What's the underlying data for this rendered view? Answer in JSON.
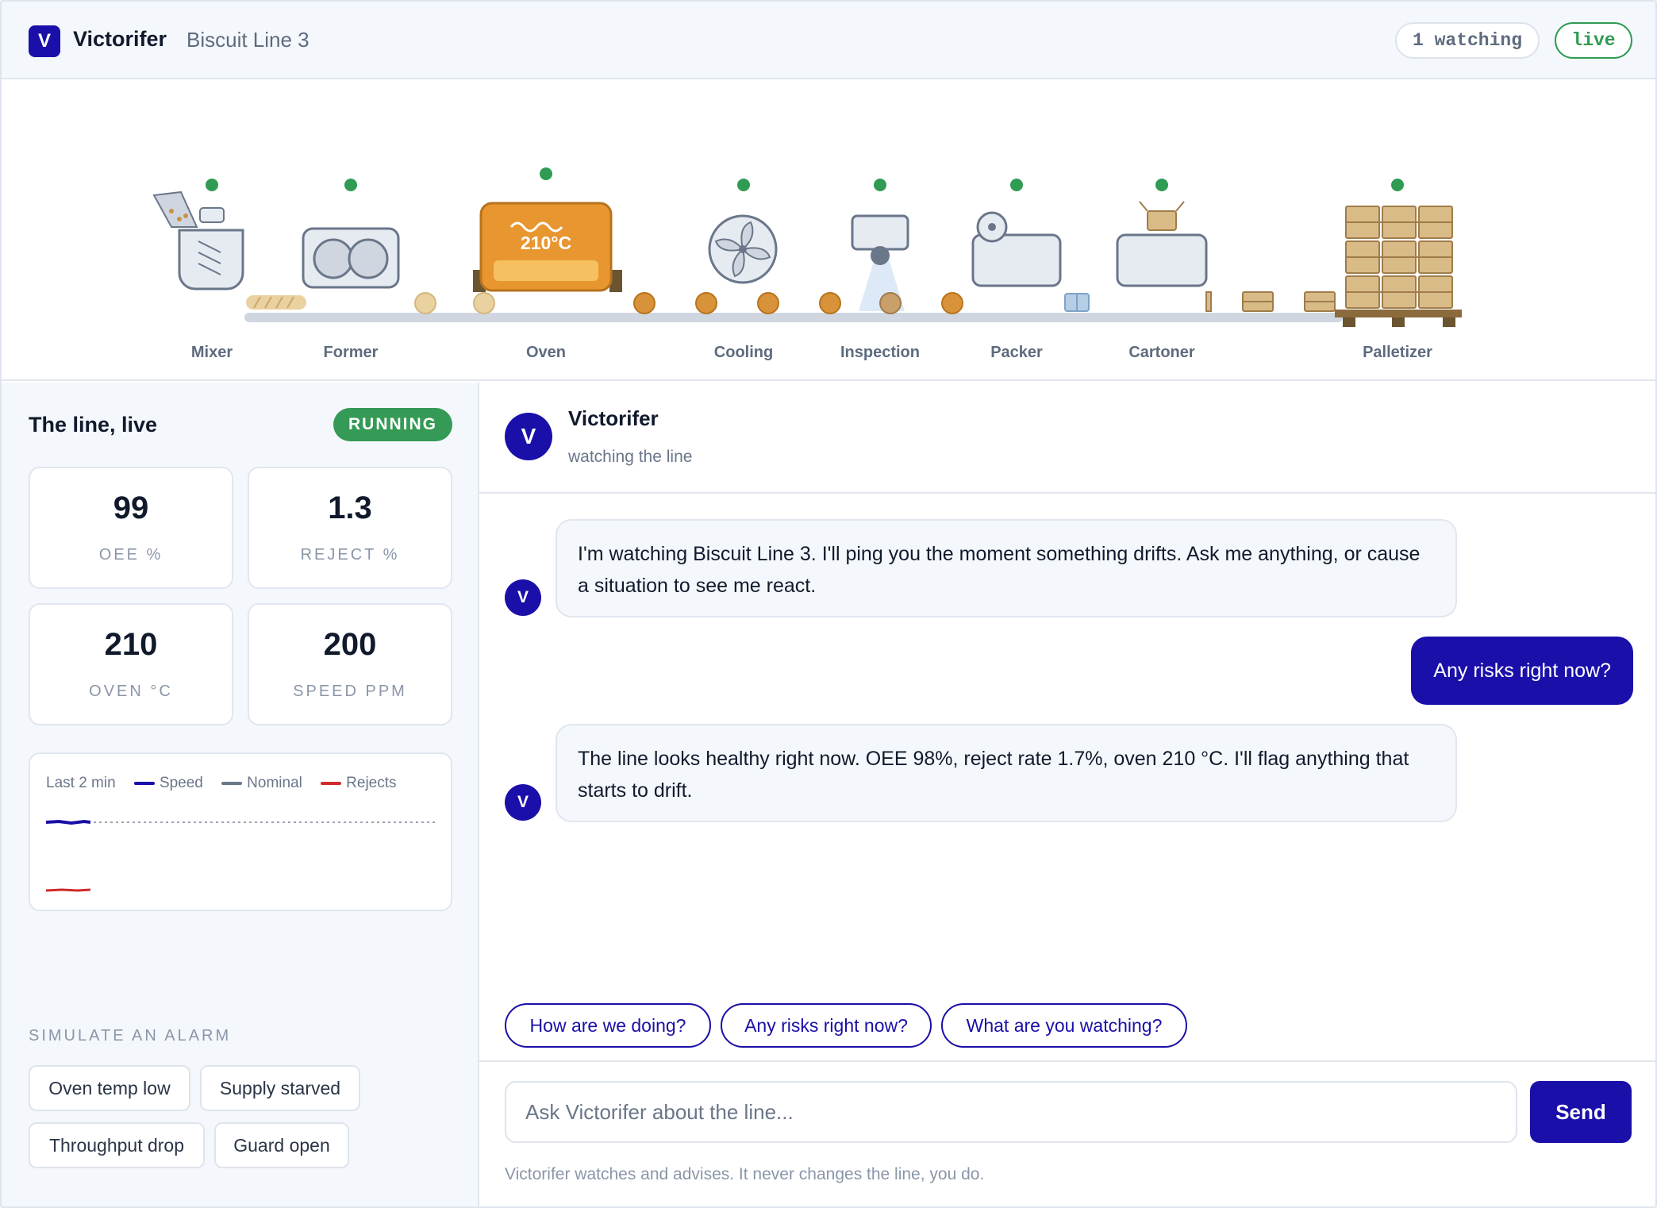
{
  "header": {
    "logo_letter": "V",
    "brand": "Victorifer",
    "line_name": "Biscuit Line 3",
    "watching": "1 watching",
    "live": "live"
  },
  "line": {
    "oven_temp": "210°C",
    "stations": [
      {
        "name": "Mixer",
        "status": "ok"
      },
      {
        "name": "Former",
        "status": "ok"
      },
      {
        "name": "Oven",
        "status": "ok"
      },
      {
        "name": "Cooling",
        "status": "ok"
      },
      {
        "name": "Inspection",
        "status": "ok"
      },
      {
        "name": "Packer",
        "status": "ok"
      },
      {
        "name": "Cartoner",
        "status": "ok"
      },
      {
        "name": "Palletizer",
        "status": "ok"
      }
    ],
    "status_color": "#2f9b53"
  },
  "panel": {
    "title": "The line, live",
    "status": "RUNNING",
    "kpis": [
      {
        "value": "99",
        "label": "OEE %"
      },
      {
        "value": "1.3",
        "label": "REJECT %"
      },
      {
        "value": "210",
        "label": "OVEN °C"
      },
      {
        "value": "200",
        "label": "SPEED PPM"
      }
    ],
    "spark": {
      "window": "Last 2 min",
      "legend": [
        {
          "name": "Speed",
          "color": "#1a0fa8"
        },
        {
          "name": "Nominal",
          "color": "#6a7689"
        },
        {
          "name": "Rejects",
          "color": "#d02a2a"
        }
      ]
    },
    "sim_title": "SIMULATE AN ALARM",
    "sim_buttons": [
      "Oven temp low",
      "Supply starved",
      "Throughput drop",
      "Guard open"
    ]
  },
  "chat": {
    "avatar_letter": "V",
    "name": "Victorifer",
    "subtitle": "watching the line",
    "messages": [
      {
        "from": "bot",
        "text": "I'm watching Biscuit Line 3. I'll ping you the moment something drifts. Ask me anything, or cause a situation to see me react."
      },
      {
        "from": "user",
        "text": "Any risks right now?"
      },
      {
        "from": "bot",
        "text": "The line looks healthy right now. OEE 98%, reject rate 1.7%, oven 210 °C. I'll flag anything that starts to drift."
      }
    ],
    "suggestions": [
      "How are we doing?",
      "Any risks right now?",
      "What are you watching?"
    ],
    "input_placeholder": "Ask Victorifer about the line...",
    "send_label": "Send",
    "disclaimer": "Victorifer watches and advises. It never changes the line, you do."
  },
  "colors": {
    "accent": "#1a0fa8",
    "ok": "#2f9b53",
    "oven": "#e8962f"
  }
}
